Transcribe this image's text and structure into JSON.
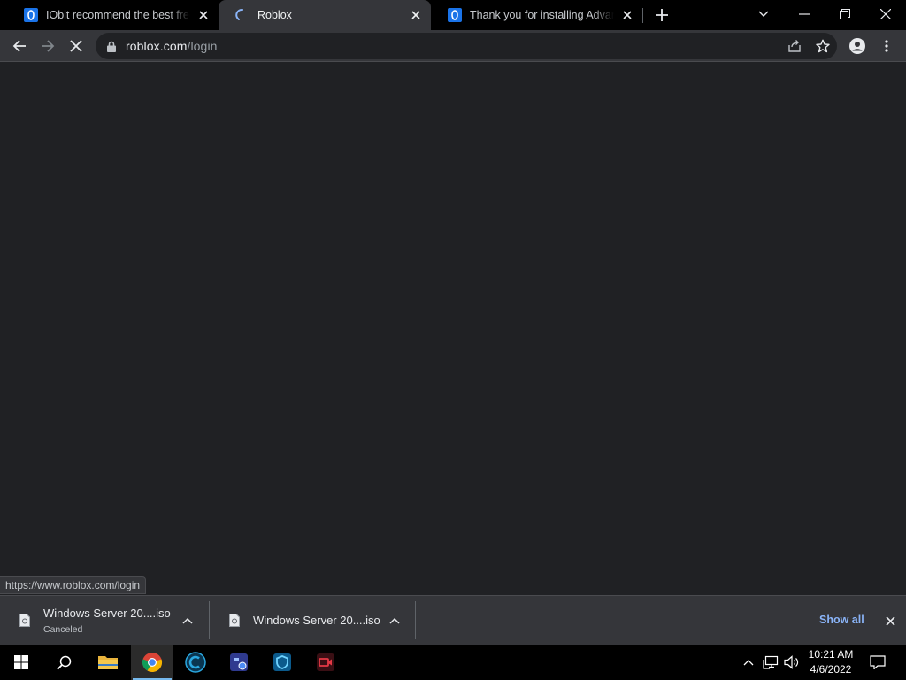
{
  "browser": {
    "tabs": [
      {
        "title": "IObit recommend the best free, s",
        "favicon": "iobit-icon",
        "active": false
      },
      {
        "title": "Roblox",
        "favicon": "loading-spinner-icon",
        "active": true
      },
      {
        "title": "Thank you for installing Advanced",
        "favicon": "iobit-icon",
        "active": false
      }
    ],
    "address_bar": {
      "host": "roblox.com",
      "path": "/login"
    },
    "status_url": "https://www.roblox.com/login"
  },
  "downloads": {
    "items": [
      {
        "name": "Windows Server 20....iso",
        "status": "Canceled"
      },
      {
        "name": "Windows Server 20....iso",
        "status": ""
      }
    ],
    "show_all_label": "Show all"
  },
  "taskbar": {
    "pinned": [
      "windows-start-icon",
      "search-icon",
      "file-explorer-icon",
      "chrome-icon",
      "ccleaner-icon",
      "driver-booster-icon",
      "malware-fighter-icon",
      "screen-recorder-icon"
    ],
    "time": "10:21 AM",
    "date": "4/6/2022"
  },
  "colors": {
    "tab_strip": "#000000",
    "toolbar": "#35363a",
    "page_background": "#202124",
    "link_accent": "#8ab4f8",
    "taskbar": "#000000",
    "taskbar_active_indicator": "#76b9ed"
  }
}
